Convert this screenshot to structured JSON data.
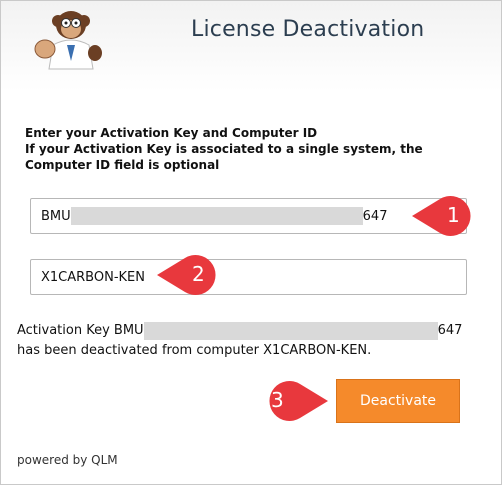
{
  "dialog": {
    "title": "License Deactivation",
    "instructions_line1": "Enter your Activation Key and Computer ID",
    "instructions_line2": "If your Activation Key is associated to a single system, the Computer ID field is optional"
  },
  "activation_key_field": {
    "prefix": "BMU",
    "suffix": "647"
  },
  "computer_id_field": {
    "value": "X1CARBON-KEN"
  },
  "result_message": {
    "part1": "Activation Key BMU",
    "part2": "647 has been deactivated from computer X1CARBON-KEN."
  },
  "deactivate_button": {
    "label": "Deactivate"
  },
  "footer": {
    "text": "powered by QLM"
  },
  "callouts": [
    {
      "number": "1"
    },
    {
      "number": "2"
    },
    {
      "number": "3"
    }
  ],
  "colors": {
    "accent": "#f58a2b",
    "callout": "#e8383d",
    "title": "#2c3e50"
  }
}
